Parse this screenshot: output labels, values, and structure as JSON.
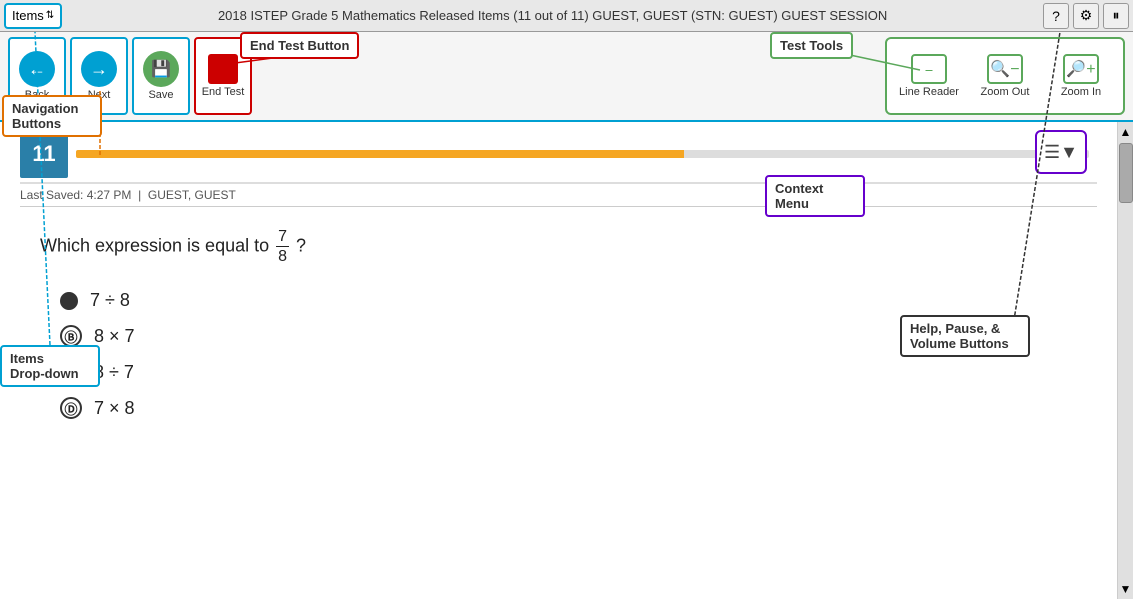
{
  "topbar": {
    "items_label": "Items",
    "items_arrow": "⇅",
    "title": "2018 ISTEP Grade 5 Mathematics Released Items (11 out of 11)   GUEST, GUEST (STN: GUEST)   GUEST SESSION",
    "help_btn": "?",
    "settings_btn": "⚙",
    "pause_btn": "⏸"
  },
  "navbar": {
    "back_label": "Back",
    "next_label": "Next",
    "save_label": "Save",
    "end_label": "End Test",
    "test_tools_label": "Test Tools",
    "line_reader_label": "Line Reader",
    "zoom_out_label": "Zoom Out",
    "zoom_in_label": "Zoom In"
  },
  "callouts": {
    "navigation": "Navigation\nButtons",
    "end_test": "End Test Button",
    "test_tools": "Test Tools",
    "context_menu": "Context\nMenu",
    "items_dropdown": "Items\nDrop-down",
    "help_pause": "Help, Pause, &\nVolume Buttons"
  },
  "question": {
    "number": "11",
    "saved_info": "Last Saved: 4:27 PM",
    "saved_user": "GUEST, GUEST",
    "text_before": "Which expression is equal to ",
    "fraction_num": "7",
    "fraction_den": "8",
    "text_after": "?",
    "choices": [
      {
        "label": "A",
        "filled": true,
        "text": "7 ÷ 8"
      },
      {
        "label": "B",
        "filled": false,
        "text": "8 × 7"
      },
      {
        "label": "C",
        "filled": false,
        "text": "8 ÷ 7"
      },
      {
        "label": "D",
        "filled": false,
        "text": "7 × 8"
      }
    ]
  }
}
